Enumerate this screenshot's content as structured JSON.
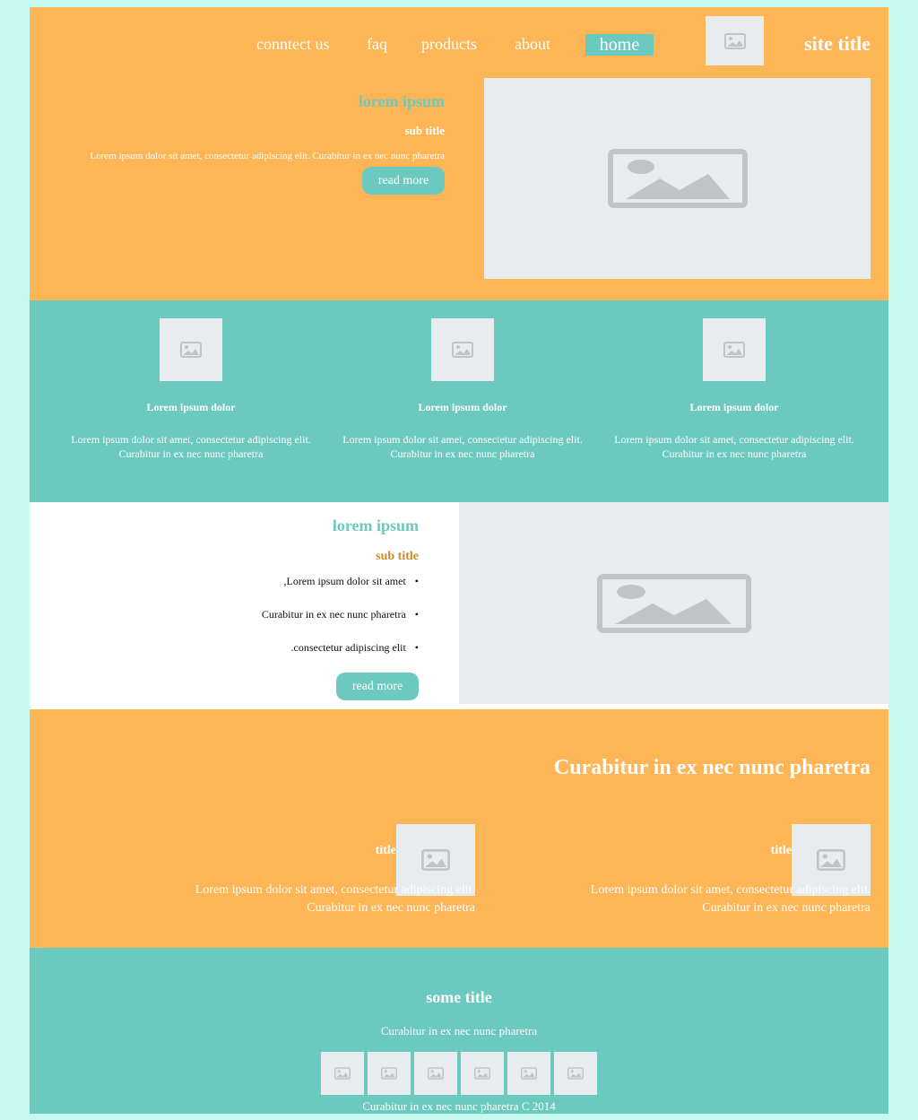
{
  "header": {
    "site_title": "site title",
    "nav": [
      "conntect us",
      "faq",
      "products",
      "about",
      "home"
    ]
  },
  "hero": {
    "heading": "lorem ipsum",
    "subtitle": "sub title",
    "text": "Lorem ipsum dolor sit amet, consectetur adipiscing elit. Curabitur in ex nec nunc pharetra",
    "button": "read more"
  },
  "features": [
    {
      "title": "Lorem ipsum dolor",
      "text1": "Lorem ipsum dolor sit amet, consectetur adipiscing elit.",
      "text2": "Curabitur in ex nec nunc pharetra"
    },
    {
      "title": "Lorem ipsum dolor",
      "text1": "Lorem ipsum dolor sit amet, consectetur adipiscing elit.",
      "text2": "Curabitur in ex nec nunc pharetra"
    },
    {
      "title": "Lorem ipsum dolor",
      "text1": "Lorem ipsum dolor sit amet, consectetur adipiscing elit.",
      "text2": "Curabitur in ex nec nunc pharetra"
    }
  ],
  "about": {
    "heading": "lorem ipsum",
    "subtitle": "sub title",
    "items": [
      ",Lorem ipsum dolor sit amet",
      "Curabitur in ex nec nunc pharetra",
      ".consectetur adipiscing elit"
    ],
    "button": "read more"
  },
  "promo": {
    "heading": "Curabitur in ex nec nunc pharetra",
    "cards": [
      {
        "title": "title",
        "text1": "Lorem ipsum dolor sit amet, consectetur adipiscing elit.",
        "text2": "Curabitur in ex nec nunc pharetra"
      },
      {
        "title": "title",
        "text1": "Lorem ipsum dolor sit amet, consectetur adipiscing elit.",
        "text2": "Curabitur in ex nec nunc pharetra"
      }
    ]
  },
  "footer": {
    "heading": "some title",
    "text": "Curabitur in ex nec nunc pharetra",
    "thumb_icons": [
      "image-icon",
      "image-icon",
      "image-icon",
      "image-icon",
      "image-icon",
      "image-icon"
    ],
    "copyright": "Curabitur in ex nec nunc pharetra C 2014"
  },
  "colors": {
    "background": "#c8f9f1",
    "orange": "#fdb556",
    "teal": "#6cc9c0",
    "placeholder": "#e8ecef",
    "placeholder_icon": "#bfc4c8",
    "accent_text": "#c98a2b"
  }
}
